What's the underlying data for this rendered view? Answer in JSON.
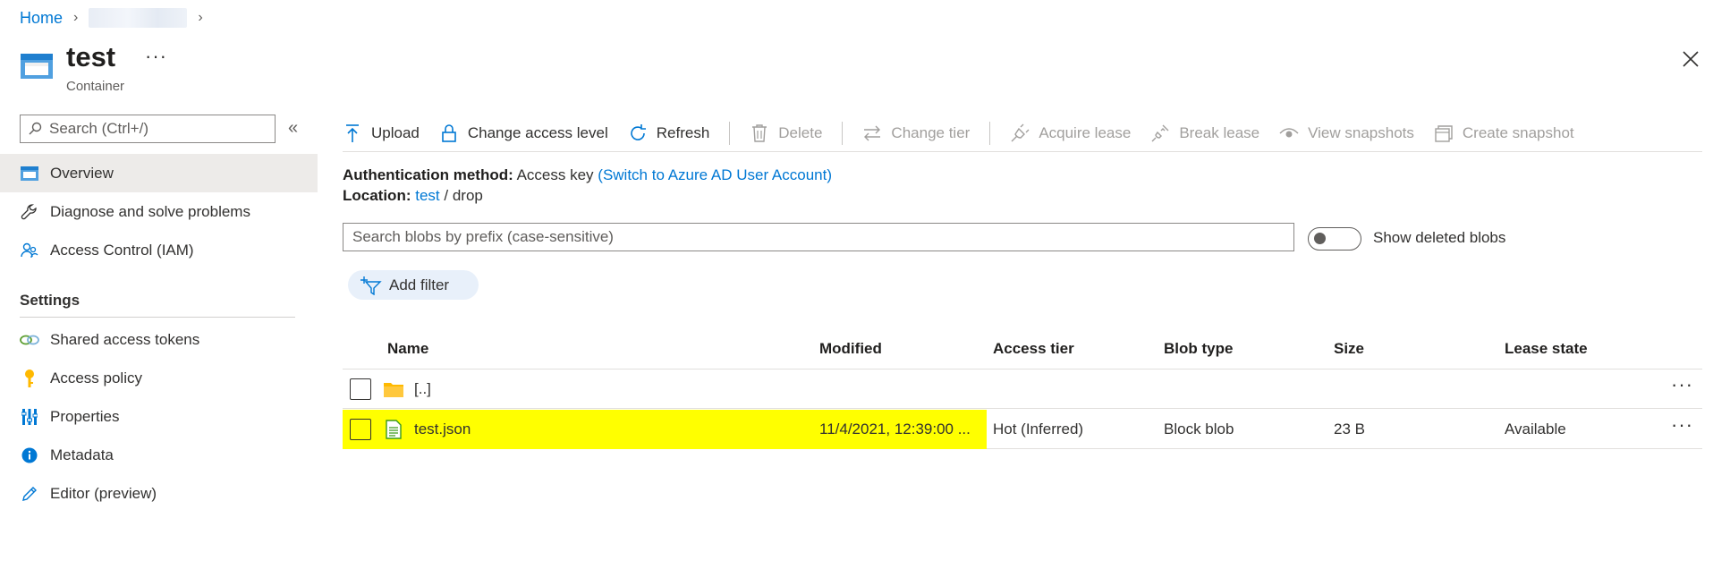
{
  "breadcrumb": {
    "home": "Home"
  },
  "header": {
    "title": "test",
    "subtitle": "Container",
    "more": "···"
  },
  "sidebar": {
    "search_placeholder": "Search (Ctrl+/)",
    "collapse": "«",
    "items": [
      {
        "label": "Overview",
        "icon": "container-icon"
      },
      {
        "label": "Diagnose and solve problems",
        "icon": "wrench-icon"
      },
      {
        "label": "Access Control (IAM)",
        "icon": "people-icon"
      }
    ],
    "settings_heading": "Settings",
    "settings_items": [
      {
        "label": "Shared access tokens",
        "icon": "link-icon"
      },
      {
        "label": "Access policy",
        "icon": "key-icon"
      },
      {
        "label": "Properties",
        "icon": "properties-icon"
      },
      {
        "label": "Metadata",
        "icon": "info-icon"
      },
      {
        "label": "Editor (preview)",
        "icon": "pencil-icon"
      }
    ]
  },
  "toolbar": {
    "upload": "Upload",
    "change_access": "Change access level",
    "refresh": "Refresh",
    "delete": "Delete",
    "change_tier": "Change tier",
    "acquire_lease": "Acquire lease",
    "break_lease": "Break lease",
    "view_snapshots": "View snapshots",
    "create_snapshot": "Create snapshot"
  },
  "info": {
    "auth_label": "Authentication method:",
    "auth_value": "Access key",
    "auth_link": "(Switch to Azure AD User Account)",
    "location_label": "Location:",
    "location_link": "test",
    "location_sep": "/",
    "location_path": "drop"
  },
  "blob_search": {
    "placeholder": "Search blobs by prefix (case-sensitive)"
  },
  "show_deleted": {
    "label": "Show deleted blobs",
    "on": false
  },
  "add_filter": "Add filter",
  "table": {
    "headers": {
      "name": "Name",
      "modified": "Modified",
      "access_tier": "Access tier",
      "blob_type": "Blob type",
      "size": "Size",
      "lease_state": "Lease state"
    },
    "rows": [
      {
        "name": "[..]",
        "icon": "folder-icon",
        "modified": "",
        "access_tier": "",
        "blob_type": "",
        "size": "",
        "lease_state": "",
        "more": "···"
      },
      {
        "name": "test.json",
        "icon": "file-icon",
        "modified": "11/4/2021, 12:39:00 ...",
        "access_tier": "Hot (Inferred)",
        "blob_type": "Block blob",
        "size": "23 B",
        "lease_state": "Available",
        "more": "···"
      }
    ]
  },
  "colors": {
    "accent": "#0078d4",
    "highlight": "#ffff00",
    "folder": "#ffb900",
    "file": "#3a9a1a"
  }
}
